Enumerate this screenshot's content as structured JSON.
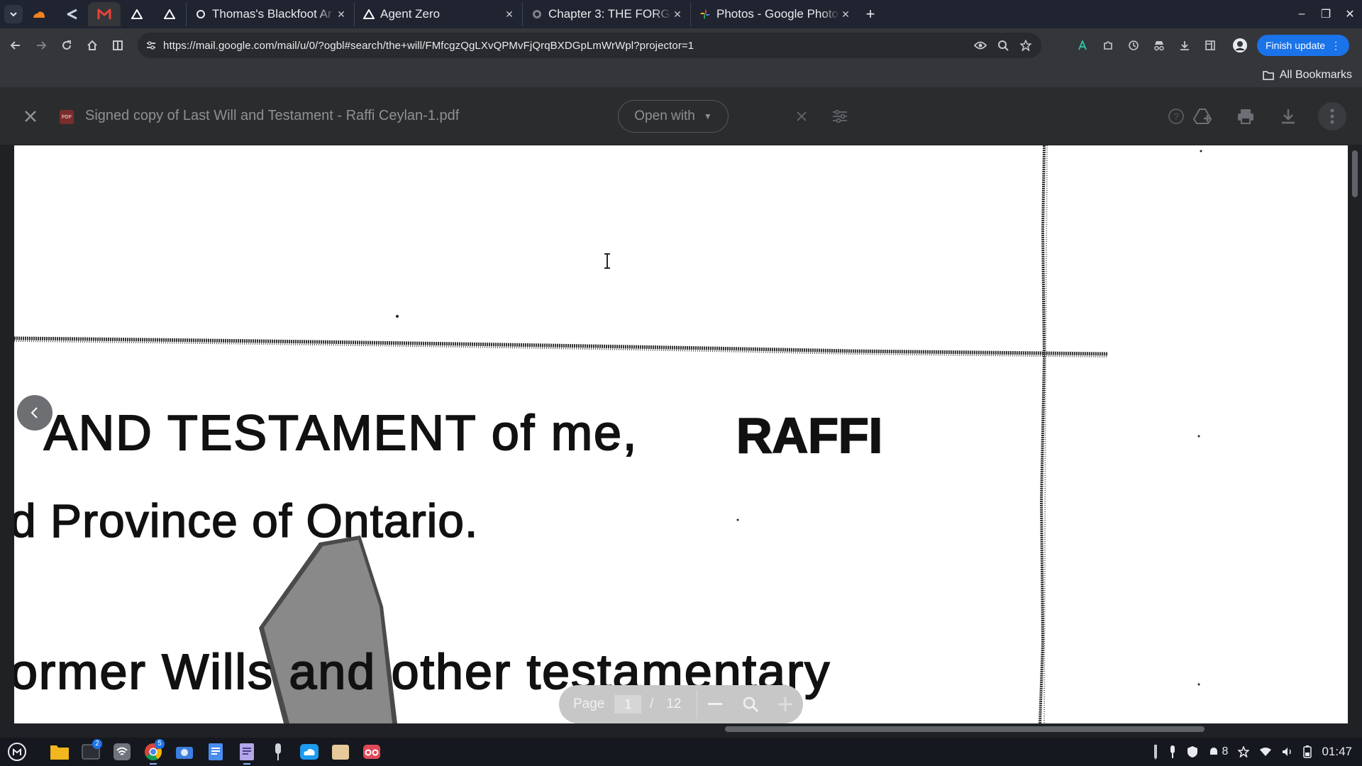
{
  "browser": {
    "tabs": [
      {
        "title": "Thomas's Blackfoot Ar",
        "icon": "threads-icon"
      },
      {
        "title": "Agent Zero",
        "icon": "triangle-logo-icon"
      },
      {
        "title": "Chapter 3: THE FORGE",
        "icon": "globe-icon"
      },
      {
        "title": "Photos - Google Photo",
        "icon": "google-photos-icon"
      }
    ],
    "pinned_tabs": [
      "cloudflare-icon",
      "share-icon",
      "gmail-icon",
      "triangle-logo-icon",
      "triangle-logo-icon"
    ],
    "close_glyph": "✕",
    "newtab_glyph": "+",
    "url": "https://mail.google.com/mail/u/0/?ogbl#search/the+will/FMfcgzQgLXvQPMvFjQrqBXDGpLmWrWpl?projector=1",
    "finish_update_label": "Finish update",
    "all_bookmarks_label": "All Bookmarks",
    "accent_color": "#1a73e8"
  },
  "viewer": {
    "file_title": "Signed copy of Last Will and Testament - Raffi Ceylan-1.pdf",
    "file_badge": "PDF",
    "open_with_label": "Open with",
    "page_label": "Page",
    "current_page": "1",
    "page_sep": "/",
    "total_pages": "12"
  },
  "document": {
    "lines": [
      {
        "text": "AND  TESTAMENT  of  me, "
      },
      {
        "text": "RAFFI"
      },
      {
        "text": "d Province of Ontario."
      },
      {
        "text": "ormer  Wills  and  other  testamentary"
      }
    ]
  },
  "taskbar": {
    "apps": [
      {
        "icon": "files-icon",
        "badge": ""
      },
      {
        "icon": "terminal-icon",
        "badge": "2"
      },
      {
        "icon": "network-icon",
        "badge": ""
      },
      {
        "icon": "chrome-icon",
        "badge": "5"
      },
      {
        "icon": "camera-icon",
        "badge": ""
      },
      {
        "icon": "docs-icon",
        "badge": ""
      },
      {
        "icon": "notes-icon",
        "badge": ""
      },
      {
        "icon": "microphone-icon",
        "badge": ""
      },
      {
        "icon": "cloud-icon",
        "badge": ""
      },
      {
        "icon": "folder-icon",
        "badge": ""
      },
      {
        "icon": "screen-capture-icon",
        "badge": ""
      }
    ],
    "tray_count": "8",
    "time": "01:47"
  }
}
